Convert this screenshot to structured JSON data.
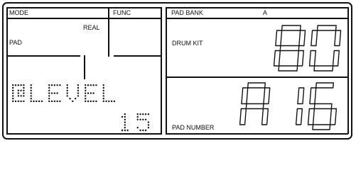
{
  "left_panel": {
    "mode_label": "MODE",
    "func_label": "FUNC",
    "real_label": "REAL",
    "pad_label": "PAD",
    "parameter_name": "LEVEL",
    "parameter_value": "15"
  },
  "right_panel": {
    "pad_bank_label": "PAD BANK",
    "pad_bank_value": "A",
    "drum_kit_label": "DRUM KIT",
    "drum_kit_value": "80",
    "pad_number_label": "PAD NUMBER",
    "pad_number_value": "A16"
  },
  "colors": {
    "lcd_ink": "#111111",
    "background": "#ffffff"
  }
}
